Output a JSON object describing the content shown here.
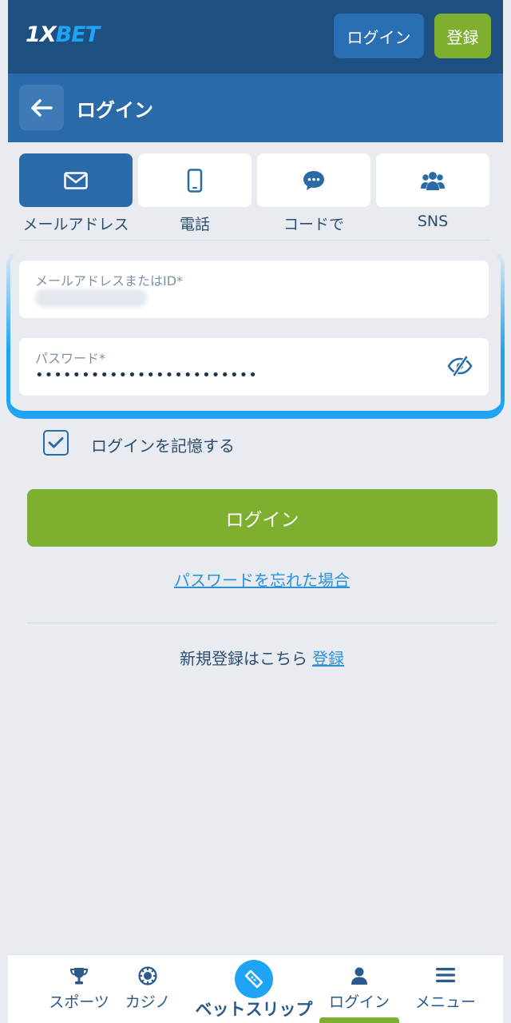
{
  "header": {
    "logo_prefix": "1X",
    "logo_suffix": "BET",
    "login_label": "ログイン",
    "register_label": "登録"
  },
  "subheader": {
    "title": "ログイン",
    "back_icon": "arrow-left-icon"
  },
  "methods": [
    {
      "label": "メールアドレス",
      "icon": "envelope-icon",
      "active": true
    },
    {
      "label": "電話",
      "icon": "phone-icon",
      "active": false
    },
    {
      "label": "コードで",
      "icon": "chat-bubble-icon",
      "active": false
    },
    {
      "label": "SNS",
      "icon": "users-icon",
      "active": false
    }
  ],
  "form": {
    "email_label": "メールアドレスまたはID*",
    "password_label": "パスワード*",
    "password_value": "••••••••••••••••••••••••"
  },
  "remember": {
    "label": "ログインを記憶する",
    "checked": true
  },
  "login_button": "ログイン",
  "forgot_password": "パスワードを忘れた場合",
  "register_prompt": {
    "text": "新規登録はこちら",
    "link": "登録"
  },
  "bottom_nav": {
    "sports": "スポーツ",
    "casino": "カジノ",
    "betslip": "ベットスリップ",
    "login": "ログイン",
    "menu": "メニュー"
  },
  "colors": {
    "header_bg": "#1d4f80",
    "subheader_bg": "#2a6aa8",
    "accent_green": "#7faf2f",
    "accent_blue": "#1fa3f5",
    "link": "#2e90d8"
  }
}
